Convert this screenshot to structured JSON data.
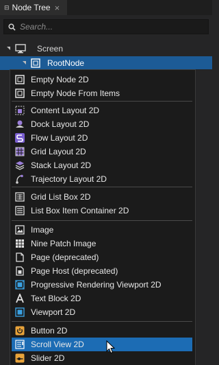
{
  "panel": {
    "tab_title": "Node Tree",
    "pin_icon": "pin-icon",
    "close_label": "×"
  },
  "search": {
    "placeholder": "Search...",
    "icon": "search-icon"
  },
  "tree": {
    "screen_label": "Screen",
    "root_label": "RootNode"
  },
  "menu": {
    "items": [
      {
        "label": "Empty Node 2D",
        "icon": "empty-node-icon"
      },
      {
        "label": "Empty Node From Items",
        "icon": "empty-node-icon"
      },
      {
        "label": "Content Layout 2D",
        "icon": "content-layout-icon"
      },
      {
        "label": "Dock Layout 2D",
        "icon": "dock-layout-icon"
      },
      {
        "label": "Flow Layout 2D",
        "icon": "flow-layout-icon"
      },
      {
        "label": "Grid Layout 2D",
        "icon": "grid-layout-icon"
      },
      {
        "label": "Stack Layout 2D",
        "icon": "stack-layout-icon"
      },
      {
        "label": "Trajectory Layout 2D",
        "icon": "trajectory-layout-icon"
      },
      {
        "label": "Grid List Box 2D",
        "icon": "grid-list-box-icon"
      },
      {
        "label": "List Box Item Container 2D",
        "icon": "list-box-icon"
      },
      {
        "label": "Image",
        "icon": "image-icon"
      },
      {
        "label": "Nine Patch Image",
        "icon": "nine-patch-icon"
      },
      {
        "label": "Page (deprecated)",
        "icon": "page-icon"
      },
      {
        "label": "Page Host (deprecated)",
        "icon": "page-host-icon"
      },
      {
        "label": "Progressive Rendering Viewport 2D",
        "icon": "viewport-icon"
      },
      {
        "label": "Text Block 2D",
        "icon": "text-block-icon"
      },
      {
        "label": "Viewport 2D",
        "icon": "viewport-icon"
      },
      {
        "label": "Button 2D",
        "icon": "button-icon"
      },
      {
        "label": "Scroll View 2D",
        "icon": "scroll-view-icon"
      },
      {
        "label": "Slider 2D",
        "icon": "slider-icon"
      }
    ],
    "selected_label": "Scroll View 2D"
  },
  "colors": {
    "selection": "#1c6cb4",
    "tree_selection": "#1c5b96",
    "accent_purple": "#9b7ed9",
    "button_orange": "#e8a33a"
  }
}
